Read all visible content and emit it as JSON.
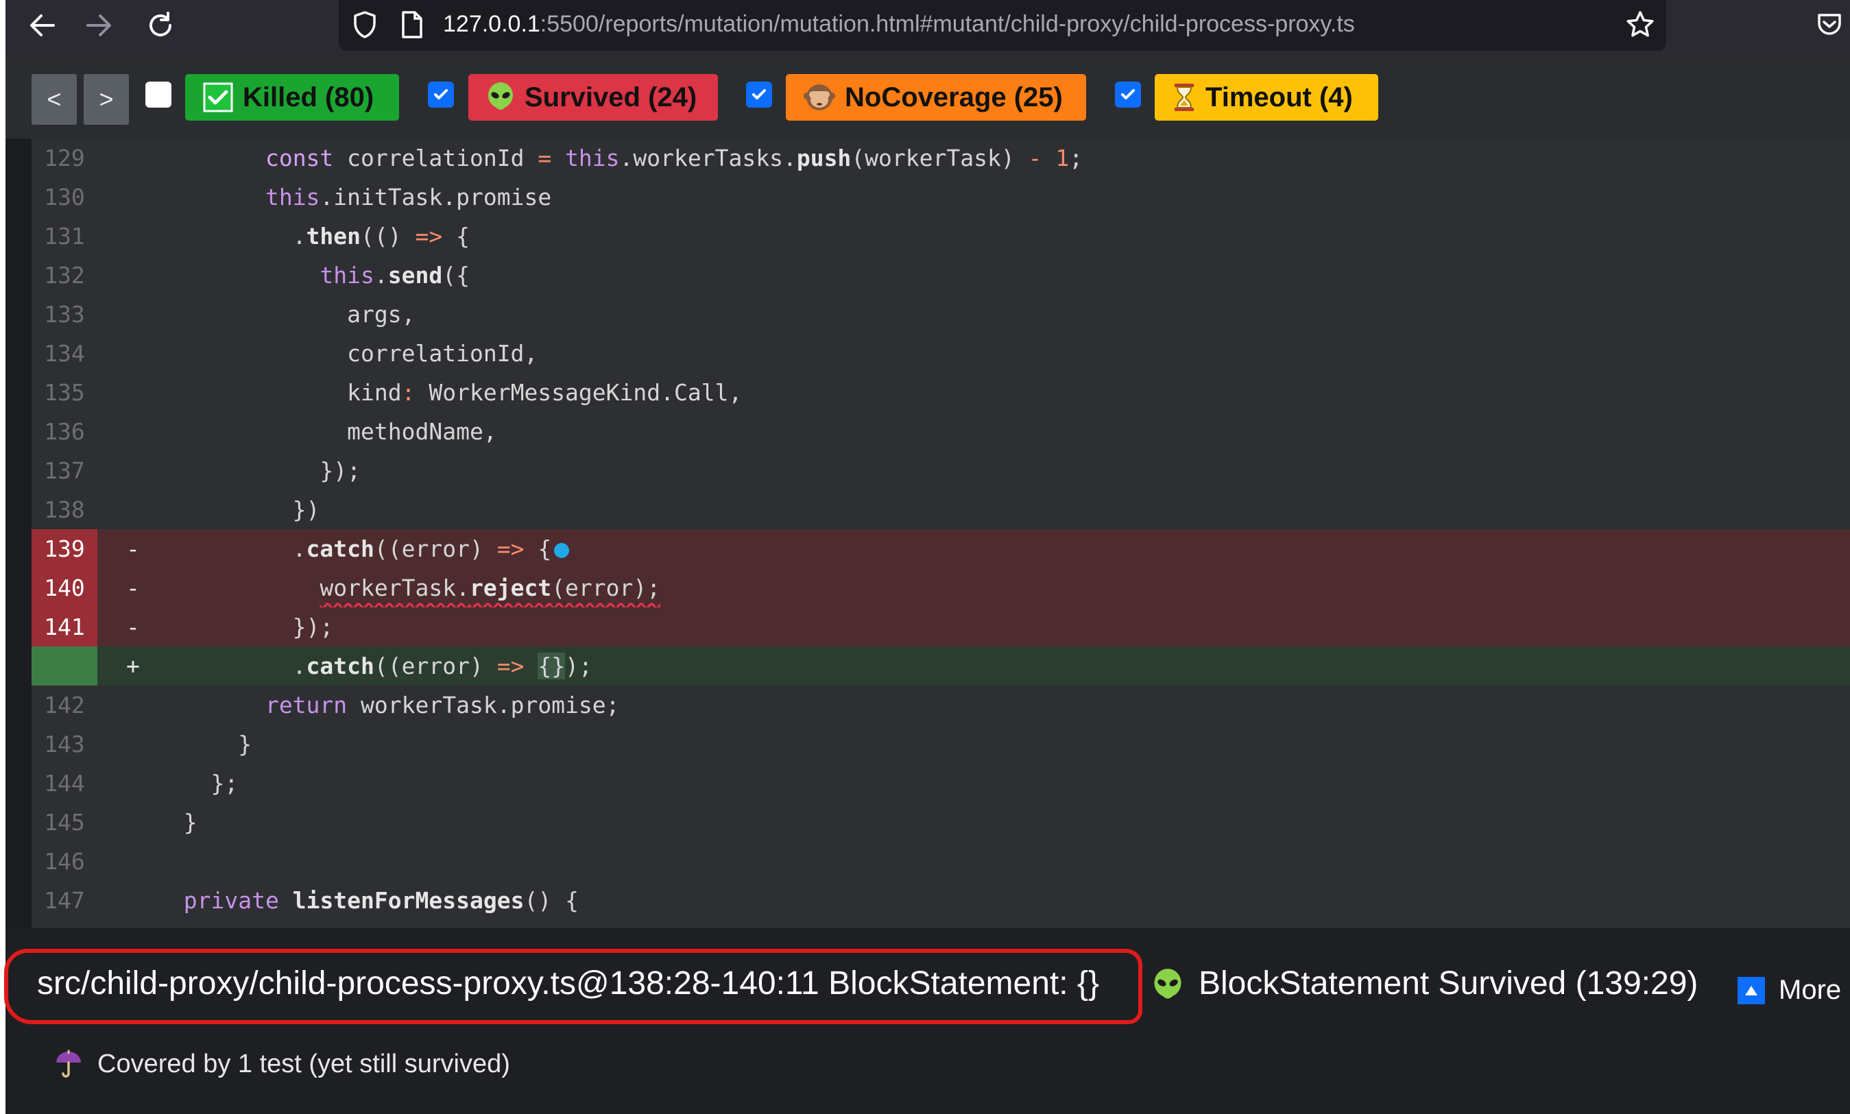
{
  "browser": {
    "url_host": "127.0.0.1",
    "url_path": ":5500/reports/mutation/mutation.html#mutant/child-proxy/child-process-proxy.ts"
  },
  "toolbar": {
    "prev_label": "<",
    "next_label": ">",
    "filters": [
      {
        "label": "Killed (80)",
        "checked": false,
        "color": "#1aa530"
      },
      {
        "label": "Survived (24)",
        "checked": true,
        "color": "#dc3545"
      },
      {
        "label": "NoCoverage (25)",
        "checked": true,
        "color": "#fd7e14"
      },
      {
        "label": "Timeout (4)",
        "checked": true,
        "color": "#ffc107"
      }
    ]
  },
  "code": {
    "lines": [
      {
        "ln": "129",
        "diff": "",
        "text": "        const correlationId = this.workerTasks.push(workerTask) - 1;"
      },
      {
        "ln": "130",
        "diff": "",
        "text": "        this.initTask.promise"
      },
      {
        "ln": "131",
        "diff": "",
        "text": "          .then(() => {"
      },
      {
        "ln": "132",
        "diff": "",
        "text": "            this.send({"
      },
      {
        "ln": "133",
        "diff": "",
        "text": "              args,"
      },
      {
        "ln": "134",
        "diff": "",
        "text": "              correlationId,"
      },
      {
        "ln": "135",
        "diff": "",
        "text": "              kind: WorkerMessageKind.Call,"
      },
      {
        "ln": "136",
        "diff": "",
        "text": "              methodName,"
      },
      {
        "ln": "137",
        "diff": "",
        "text": "            });"
      },
      {
        "ln": "138",
        "diff": "",
        "text": "          })"
      },
      {
        "ln": "139",
        "diff": "-",
        "text": "          .catch((error) => {"
      },
      {
        "ln": "140",
        "diff": "-",
        "text": "            workerTask.reject(error);"
      },
      {
        "ln": "141",
        "diff": "-",
        "text": "          });"
      },
      {
        "ln": "",
        "diff": "+",
        "text": "          .catch((error) => {});"
      },
      {
        "ln": "142",
        "diff": "",
        "text": "        return workerTask.promise;"
      },
      {
        "ln": "143",
        "diff": "",
        "text": "      }"
      },
      {
        "ln": "144",
        "diff": "",
        "text": "    };"
      },
      {
        "ln": "145",
        "diff": "",
        "text": "  }"
      },
      {
        "ln": "146",
        "diff": "",
        "text": ""
      },
      {
        "ln": "147",
        "diff": "",
        "text": "  private listenForMessages() {"
      }
    ]
  },
  "status": {
    "mutant_location": "src/child-proxy/child-process-proxy.ts@138:28-140:11 BlockStatement: {}",
    "mutant_state": "BlockStatement Survived (139:29)",
    "more_label": "More",
    "covered_text": "Covered by 1 test (yet still survived)"
  }
}
